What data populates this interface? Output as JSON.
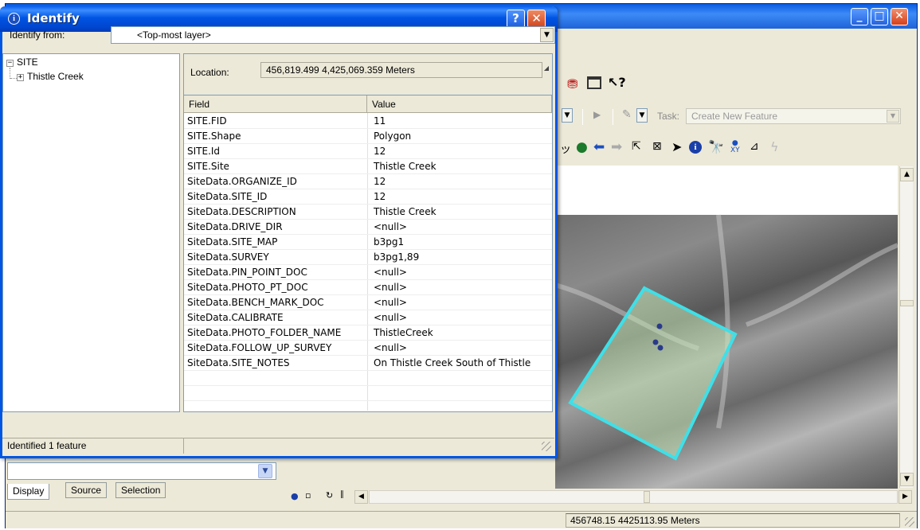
{
  "identify": {
    "title": "Identify",
    "help_label": "?",
    "close_label": "✕",
    "identify_from_label": "Identify from:",
    "identify_from_value": "<Top-most layer>",
    "tree": {
      "layer": "SITE",
      "feature": "Thistle Creek"
    },
    "location_label": "Location:",
    "location_value": "456,819.499  4,425,069.359 Meters",
    "columns": [
      "Field",
      "Value"
    ],
    "rows": [
      {
        "field": "SITE.FID",
        "value": "11"
      },
      {
        "field": "SITE.Shape",
        "value": "Polygon"
      },
      {
        "field": "SITE.Id",
        "value": "12"
      },
      {
        "field": "SITE.Site",
        "value": "Thistle Creek"
      },
      {
        "field": "SiteData.ORGANIZE_ID",
        "value": "12"
      },
      {
        "field": "SiteData.SITE_ID",
        "value": "12"
      },
      {
        "field": "SiteData.DESCRIPTION",
        "value": "Thistle Creek"
      },
      {
        "field": "SiteData.DRIVE_DIR",
        "value": "<null>"
      },
      {
        "field": "SiteData.SITE_MAP",
        "value": "b3pg1"
      },
      {
        "field": "SiteData.SURVEY",
        "value": "b3pg1,89"
      },
      {
        "field": "SiteData.PIN_POINT_DOC",
        "value": "<null>"
      },
      {
        "field": "SiteData.PHOTO_PT_DOC",
        "value": "<null>"
      },
      {
        "field": "SiteData.BENCH_MARK_DOC",
        "value": "<null>"
      },
      {
        "field": "SiteData.CALIBRATE",
        "value": "<null>"
      },
      {
        "field": "SiteData.PHOTO_FOLDER_NAME",
        "value": "ThistleCreek"
      },
      {
        "field": "SiteData.FOLLOW_UP_SURVEY",
        "value": "<null>"
      },
      {
        "field": "SiteData.SITE_NOTES",
        "value": "On Thistle Creek South of Thistle"
      }
    ],
    "status": "Identified 1 feature"
  },
  "editor": {
    "task_label": "Task:",
    "task_value": "Create New Feature"
  },
  "toc": {
    "tabs": [
      "Display",
      "Source",
      "Selection"
    ]
  },
  "status_bar": {
    "coordinates": "456748.15  4425113.95 Meters"
  },
  "icons": {
    "toolbar1": [
      "database-icon",
      "window-icon",
      "whats-this-icon"
    ],
    "toolbar3": [
      "pan-icon",
      "full-extent-icon",
      "back-icon",
      "forward-icon",
      "select-elements-icon",
      "clear-selection-icon",
      "select-pointer-icon",
      "identify-icon",
      "find-icon",
      "goto-xy-icon",
      "measure-icon",
      "hyperlink-icon"
    ]
  },
  "colors": {
    "selection_outline": "#3ee0e8",
    "xp_title_blue": "#0054e3"
  }
}
